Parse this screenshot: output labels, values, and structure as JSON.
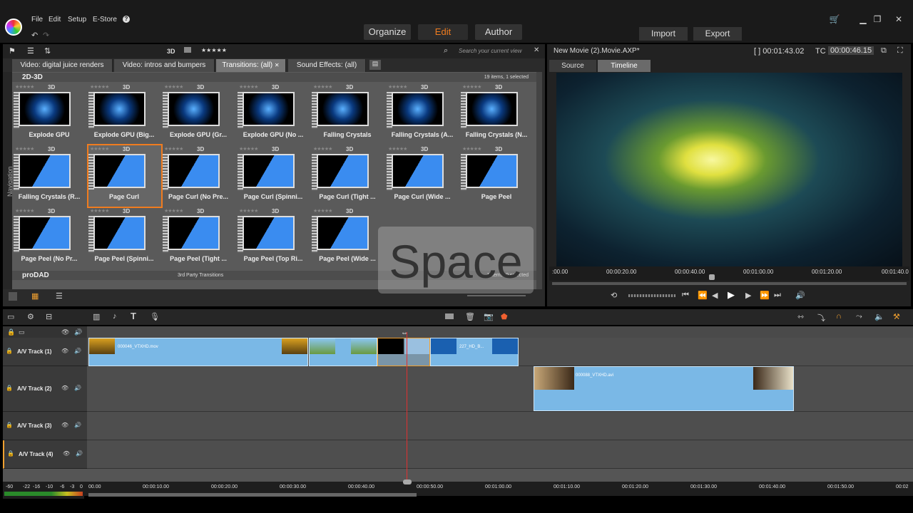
{
  "menu": {
    "file": "File",
    "edit": "Edit",
    "setup": "Setup",
    "estore": "E-Store",
    "help": "?"
  },
  "modes": {
    "organize": "Organize",
    "edit": "Edit",
    "author": "Author"
  },
  "actions": {
    "import": "Import",
    "export": "Export"
  },
  "library": {
    "toolbar": {
      "d3": "3D",
      "stars": "★★★★★",
      "search_placeholder": "Search your current view"
    },
    "tabs": [
      "Video: digital juice renders",
      "Video: intros and bumpers",
      "Transitions: (all)",
      "Sound Effects: (all)"
    ],
    "nav_label": "Navigation",
    "section1": {
      "title": "2D-3D",
      "count": "19 items, 1 selected"
    },
    "section2": {
      "title": "proDAD",
      "subtitle": "3rd Party Transitions",
      "count": "1 items, 0 selected"
    },
    "items": [
      {
        "label": "Explode GPU"
      },
      {
        "label": "Explode GPU (Big..."
      },
      {
        "label": "Explode GPU (Gr..."
      },
      {
        "label": "Explode GPU (No ..."
      },
      {
        "label": "Falling Crystals"
      },
      {
        "label": "Falling Crystals (A..."
      },
      {
        "label": "Falling Crystals (N..."
      },
      {
        "label": "Falling Crystals (R..."
      },
      {
        "label": "Page Curl"
      },
      {
        "label": "Page Curl (No Pre..."
      },
      {
        "label": "Page Curl (Spinni..."
      },
      {
        "label": "Page Curl (Tight ..."
      },
      {
        "label": "Page Curl (Wide ..."
      },
      {
        "label": "Page Peel"
      },
      {
        "label": "Page Peel (No Pr..."
      },
      {
        "label": "Page Peel (Spinni..."
      },
      {
        "label": "Page Peel (Tight ..."
      },
      {
        "label": "Page Peel (Top Ri..."
      },
      {
        "label": "Page Peel (Wide ..."
      }
    ],
    "item_stars": "★★★★★",
    "item_3d": "3D"
  },
  "osd": "Space",
  "preview": {
    "title": "New Movie (2).Movie.AXP*",
    "duration": "[ ] 00:01:43.02",
    "tc_label": "TC",
    "tc": "00:00:46.15",
    "tabs": {
      "source": "Source",
      "timeline": "Timeline"
    },
    "ruler": [
      ":00.00",
      "00:00:20.00",
      "00:00:40.00",
      "00:01:00.00",
      "00:01:20.00",
      "00:01:40.0"
    ]
  },
  "timeline": {
    "tracks": [
      "A/V Track (1)",
      "A/V Track (2)",
      "A/V Track (3)",
      "A/V Track (4)"
    ],
    "clips": {
      "c1": "000046_VTXHD.mov",
      "c2": "227_HD_B...",
      "c3": "000088_VTXHD.avi"
    },
    "ruler": [
      "00.00",
      "00:00:10.00",
      "00:00:20.00",
      "00:00:30.00",
      "00:00:40.00",
      "00:00:50.00",
      "00:01:00.00",
      "00:01:10.00",
      "00:01:20.00",
      "00:01:30.00",
      "00:01:40.00",
      "00:01:50.00",
      "00:02"
    ],
    "meter": [
      "-60",
      "-22",
      "-16",
      "-10",
      "-6",
      "-3",
      "0"
    ]
  }
}
